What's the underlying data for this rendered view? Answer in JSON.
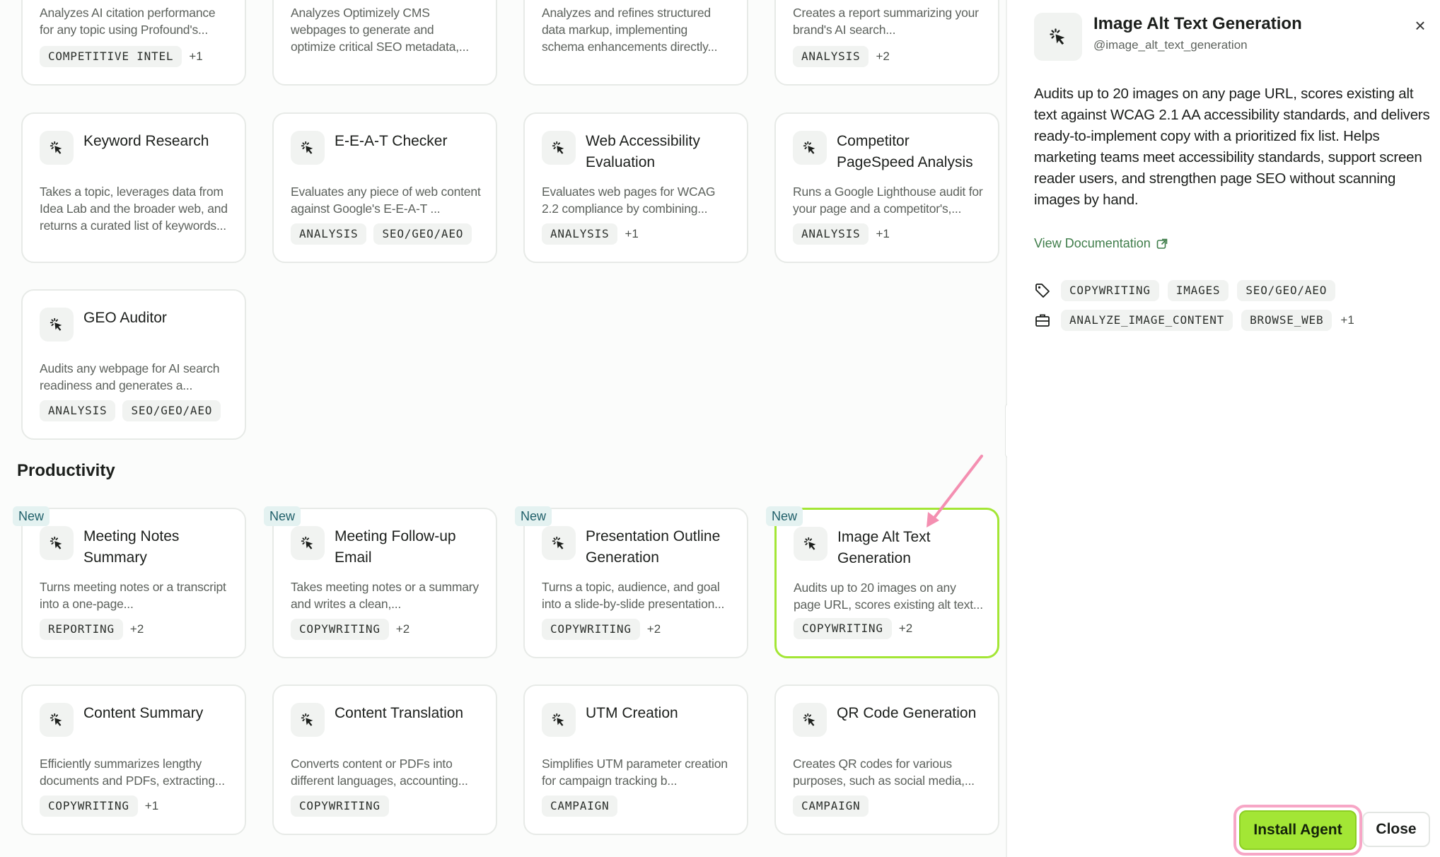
{
  "cards_top": [
    {
      "desc": "Analyzes AI citation performance for any topic using Profound's...",
      "tags": [
        "COMPETITIVE INTEL"
      ],
      "more": "+1"
    },
    {
      "desc": "Analyzes Optimizely CMS webpages to generate and optimize critical SEO metadata,...",
      "tags": [],
      "more": ""
    },
    {
      "desc": "Analyzes and refines structured data markup, implementing schema enhancements directly...",
      "tags": [],
      "more": ""
    },
    {
      "desc": "Creates a report summarizing your brand's AI search...",
      "tags": [
        "ANALYSIS"
      ],
      "more": "+2"
    }
  ],
  "cards_row1": [
    {
      "title": "Keyword Research",
      "desc": "Takes a topic, leverages data from Idea Lab and the broader web, and returns a curated list of keywords...",
      "tags": [],
      "more": ""
    },
    {
      "title": "E-E-A-T Checker",
      "desc": "Evaluates any piece of web content against Google's E-E-A-T ...",
      "tags": [
        "ANALYSIS",
        "SEO/GEO/AEO"
      ],
      "more": ""
    },
    {
      "title": "Web Accessibility Evaluation",
      "desc": "Evaluates web pages for WCAG 2.2 compliance by combining...",
      "tags": [
        "ANALYSIS"
      ],
      "more": "+1"
    },
    {
      "title": "Competitor PageSpeed Analysis",
      "desc": "Runs a Google Lighthouse audit for your page and a competitor's,...",
      "tags": [
        "ANALYSIS"
      ],
      "more": "+1"
    }
  ],
  "cards_row2": [
    {
      "title": "GEO Auditor",
      "desc": "Audits any webpage for AI search readiness and generates a...",
      "tags": [
        "ANALYSIS",
        "SEO/GEO/AEO"
      ],
      "more": ""
    }
  ],
  "section_title": "Productivity",
  "new_label": "New",
  "cards_row3": [
    {
      "title": "Meeting Notes Summary",
      "desc": "Turns meeting notes or a transcript into a one-page...",
      "tags": [
        "REPORTING"
      ],
      "more": "+2"
    },
    {
      "title": "Meeting Follow-up Email",
      "desc": "Takes meeting notes or a summary and writes a clean,...",
      "tags": [
        "COPYWRITING"
      ],
      "more": "+2"
    },
    {
      "title": "Presentation Outline Generation",
      "desc": "Turns a topic, audience, and goal into a slide-by-slide presentation...",
      "tags": [
        "COPYWRITING"
      ],
      "more": "+2"
    },
    {
      "title": "Image Alt Text Generation",
      "desc": "Audits up to 20 images on any page URL, scores existing alt text...",
      "tags": [
        "COPYWRITING"
      ],
      "more": "+2"
    }
  ],
  "cards_row4": [
    {
      "title": "Content Summary",
      "desc": "Efficiently summarizes lengthy documents and PDFs, extracting...",
      "tags": [
        "COPYWRITING"
      ],
      "more": "+1"
    },
    {
      "title": "Content Translation",
      "desc": "Converts content or PDFs into different languages, accounting...",
      "tags": [
        "COPYWRITING"
      ],
      "more": ""
    },
    {
      "title": "UTM Creation",
      "desc": "Simplifies UTM parameter creation for campaign tracking b...",
      "tags": [
        "CAMPAIGN"
      ],
      "more": ""
    },
    {
      "title": "QR Code Generation",
      "desc": "Creates QR codes for various purposes, such as social media,...",
      "tags": [
        "CAMPAIGN"
      ],
      "more": ""
    }
  ],
  "panel": {
    "title": "Image Alt Text Generation",
    "handle": "@image_alt_text_generation",
    "description": "Audits up to 20 images on any page URL, scores existing alt text against WCAG 2.1 AA accessibility standards, and delivers ready-to-implement copy with a prioritized fix list. Helps marketing teams meet accessibility standards, support screen reader users, and strengthen page SEO without scanning images by hand.",
    "doc_link": "View Documentation",
    "tags": [
      "COPYWRITING",
      "IMAGES",
      "SEO/GEO/AEO"
    ],
    "tools": [
      "ANALYZE_IMAGE_CONTENT",
      "BROWSE_WEB"
    ],
    "tools_more": "+1",
    "install_label": "Install Agent",
    "close_label": "Close",
    "close_icon": "×"
  },
  "colors": {
    "accent": "#a3e635",
    "highlight": "#f7a6c6",
    "new_badge_bg": "#e4f2f1",
    "new_badge_text": "#1f5f69",
    "link": "#3f7d4a"
  },
  "icons": {
    "agent": "sparkle-cursor-icon",
    "tag": "tag-icon",
    "tools": "toolbox-icon",
    "external": "external-link-icon",
    "close": "close-icon"
  }
}
